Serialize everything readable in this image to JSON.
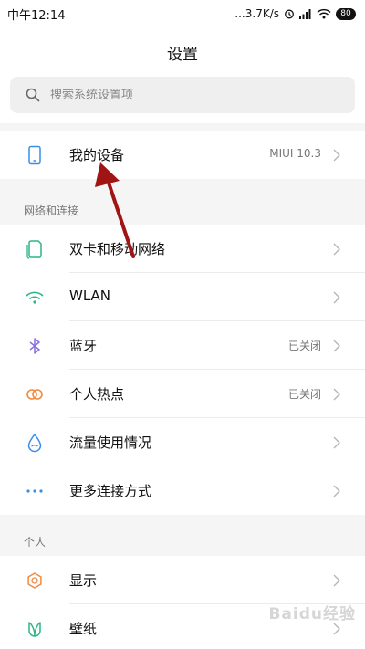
{
  "status_bar": {
    "time": "中午12:14",
    "network_speed": "...3.7K/s",
    "battery": "80"
  },
  "header": {
    "title": "设置"
  },
  "search": {
    "placeholder": "搜索系统设置项"
  },
  "device": {
    "label": "我的设备",
    "status": "MIUI 10.3"
  },
  "network_section": {
    "title": "网络和连接",
    "items": [
      {
        "label": "双卡和移动网络",
        "status": ""
      },
      {
        "label": "WLAN",
        "status": ""
      },
      {
        "label": "蓝牙",
        "status": "已关闭"
      },
      {
        "label": "个人热点",
        "status": "已关闭"
      },
      {
        "label": "流量使用情况",
        "status": ""
      },
      {
        "label": "更多连接方式",
        "status": ""
      }
    ]
  },
  "personal_section": {
    "title": "个人",
    "items": [
      {
        "label": "显示",
        "status": ""
      },
      {
        "label": "壁纸",
        "status": ""
      }
    ]
  },
  "watermark": "Baidu经验",
  "colors": {
    "icon_blue": "#3a8ee6",
    "icon_green": "#2cb58a",
    "icon_purple": "#8a6fe0",
    "icon_orange": "#f08a40",
    "annotation_arrow": "#a01414"
  }
}
